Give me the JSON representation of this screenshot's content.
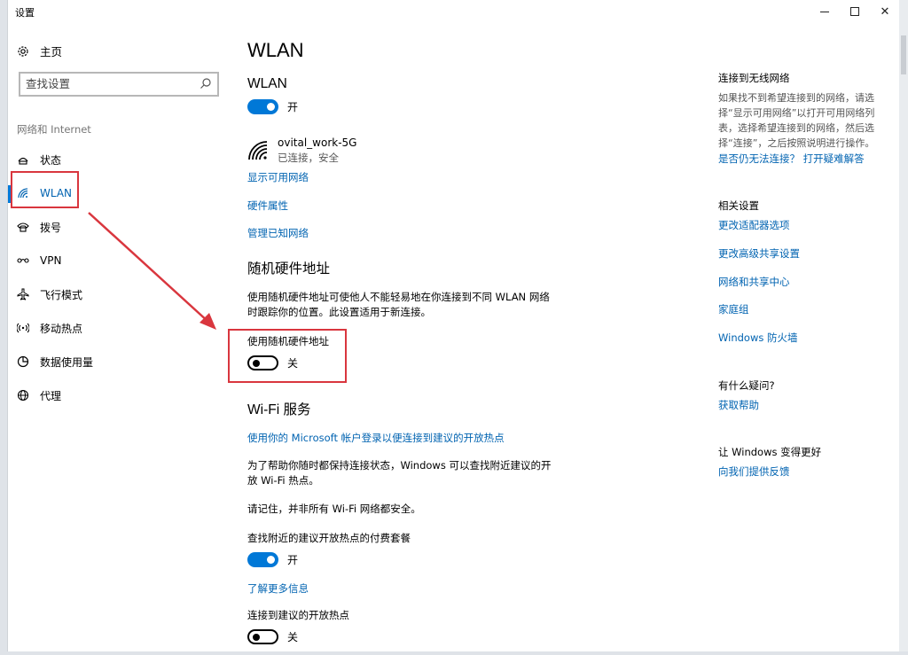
{
  "window": {
    "title": "设置",
    "minimize": "—",
    "close": "✕"
  },
  "sidebar": {
    "home_label": "主页",
    "search_placeholder": "查找设置",
    "section_label": "网络和 Internet",
    "items": [
      {
        "label": "状态",
        "icon": "status-icon"
      },
      {
        "label": "WLAN",
        "icon": "wifi-icon",
        "active": true
      },
      {
        "label": "拨号",
        "icon": "dialup-icon"
      },
      {
        "label": "VPN",
        "icon": "vpn-icon"
      },
      {
        "label": "飞行模式",
        "icon": "airplane-icon"
      },
      {
        "label": "移动热点",
        "icon": "hotspot-icon"
      },
      {
        "label": "数据使用量",
        "icon": "data-usage-icon"
      },
      {
        "label": "代理",
        "icon": "globe-icon"
      }
    ]
  },
  "main": {
    "page_title": "WLAN",
    "wlan_heading": "WLAN",
    "wlan_toggle": {
      "state": "on",
      "label": "开"
    },
    "network": {
      "name": "ovital_work-5G",
      "status": "已连接，安全"
    },
    "links": {
      "show_networks": "显示可用网络",
      "hardware_props": "硬件属性",
      "manage_known": "管理已知网络"
    },
    "random_hw": {
      "heading": "随机硬件地址",
      "desc_line1": "使用随机硬件地址可使他人不能轻易地在你连接到不同 WLAN 网络",
      "desc_line2": "时跟踪你的位置。此设置适用于新连接。",
      "toggle_title": "使用随机硬件地址",
      "toggle": {
        "state": "off",
        "label": "关"
      }
    },
    "wifi_services": {
      "heading": "Wi-Fi 服务",
      "ms_link": "使用你的 Microsoft 帐户登录以便连接到建议的开放热点",
      "desc_line1": "为了帮助你随时都保持连接状态，Windows 可以查找附近建议的开",
      "desc_line2": "放 Wi-Fi 热点。",
      "warning": "请记住，并非所有 Wi-Fi 网络都安全。",
      "paid_title": "查找附近的建议开放热点的付费套餐",
      "paid_toggle": {
        "state": "on",
        "label": "开"
      },
      "learn_more": "了解更多信息",
      "connect_title": "连接到建议的开放热点",
      "connect_toggle": {
        "state": "off",
        "label": "关"
      }
    }
  },
  "right": {
    "connect_heading": "连接到无线网络",
    "connect_text": [
      "如果找不到希望连接到的网络，请选",
      "择“显示可用网络”以打开可用网络列",
      "表，选择希望连接到的网络，然后选",
      "择“连接”，之后按照说明进行操作。"
    ],
    "trouble_link": "是否仍无法连接？ 打开疑难解答",
    "related_heading": "相关设置",
    "related_links": [
      "更改适配器选项",
      "更改高级共享设置",
      "网络和共享中心",
      "家庭组",
      "Windows 防火墙"
    ],
    "question_heading": "有什么疑问?",
    "help_link": "获取帮助",
    "better_heading": "让 Windows 变得更好",
    "feedback_link": "向我们提供反馈"
  },
  "colors": {
    "accent": "#0078d7",
    "link": "#0063b1",
    "annotation": "#d9363e"
  }
}
